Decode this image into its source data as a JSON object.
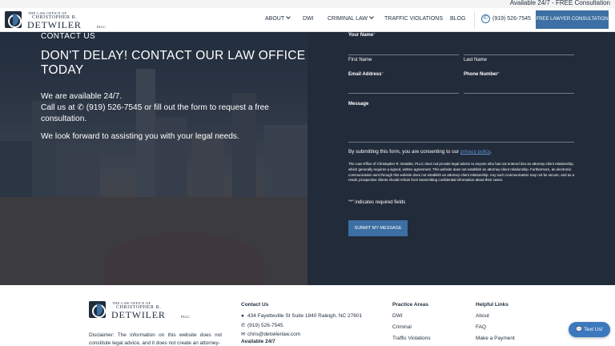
{
  "topbar": {
    "text": "Available 24/7 - FREE Consultation"
  },
  "logo": {
    "line1": "THE LAW OFFICE OF",
    "line2": "CHRISTOPHER R.",
    "line3": "DETWILER",
    "line4": "PLLC"
  },
  "nav": {
    "items": [
      {
        "label": "ABOUT",
        "has_dropdown": true
      },
      {
        "label": "DWI",
        "has_dropdown": false
      },
      {
        "label": "CRIMINAL LAW",
        "has_dropdown": true
      },
      {
        "label": "TRAFFIC VIOLATIONS",
        "has_dropdown": false
      },
      {
        "label": "BLOG",
        "has_dropdown": false
      }
    ],
    "phone": "(919) 526-7545",
    "cta": "FREE LAWYER CONSULTATION",
    "phone_icon": "phone-icon"
  },
  "hero": {
    "kicker": "CONTACT US",
    "title_line1": "DON'T DELAY! CONTACT OUR LAW OFFICE",
    "title_line2": "TODAY",
    "p1": "We are available 24/7.",
    "p2a": "Call us at",
    "p2b": "(919) 526-7545 or fill out the form to request a free",
    "p2c": "consultation.",
    "p3": "We look forward to assisting you with your legal needs."
  },
  "form": {
    "name_label": "Your Name",
    "first_name": "First Name",
    "last_name": "Last Name",
    "email_label": "Email Address",
    "phone_label": "Phone Number",
    "message_label": "Message",
    "required_mark": "*",
    "consent_text": "By submitting this form, you are consenting to our",
    "consent_link": "privacy policy",
    "consent_end": ".",
    "disclaimer": "The Law Office of Christopher R. Detwiler, PLLC does not provide legal advice to anyone who has not entered into an attorney-client relationship, which generally requires a signed, written agreement. This website does not establish an attorney-client relationship. Furthermore, an electronic communication sent through this website does not establish an attorney-client relationship. Any such communication may not be secure, and as a result, prospective clients should refrain from transmitting confidential information about their cases.",
    "required_note": "\"*\" indicates required fields",
    "submit": "SUBMIT MY MESSAGE"
  },
  "footer": {
    "disclaimer": "Disclaimer: The information on this website does not constitute legal advice, and it does not create an attorney-",
    "contact": {
      "heading": "Contact Us",
      "address": "434 Fayetteville St Suite 1840 Raleigh, NC 27601",
      "phone": "(919) 526-7545",
      "email": "chris@detwilerlaw.com",
      "availability": "Available 24/7"
    },
    "practice": {
      "heading": "Practice Areas",
      "items": [
        "DWI",
        "Criminal",
        "Traffic Violations"
      ]
    },
    "helpful": {
      "heading": "Helpful Links",
      "items": [
        "About",
        "FAQ",
        "Make a Payment"
      ]
    },
    "textus": "Text Us!"
  },
  "colors": {
    "accent": "#3c6fa3",
    "form_bg": "#222b3a",
    "navy": "#1f2d3d"
  }
}
